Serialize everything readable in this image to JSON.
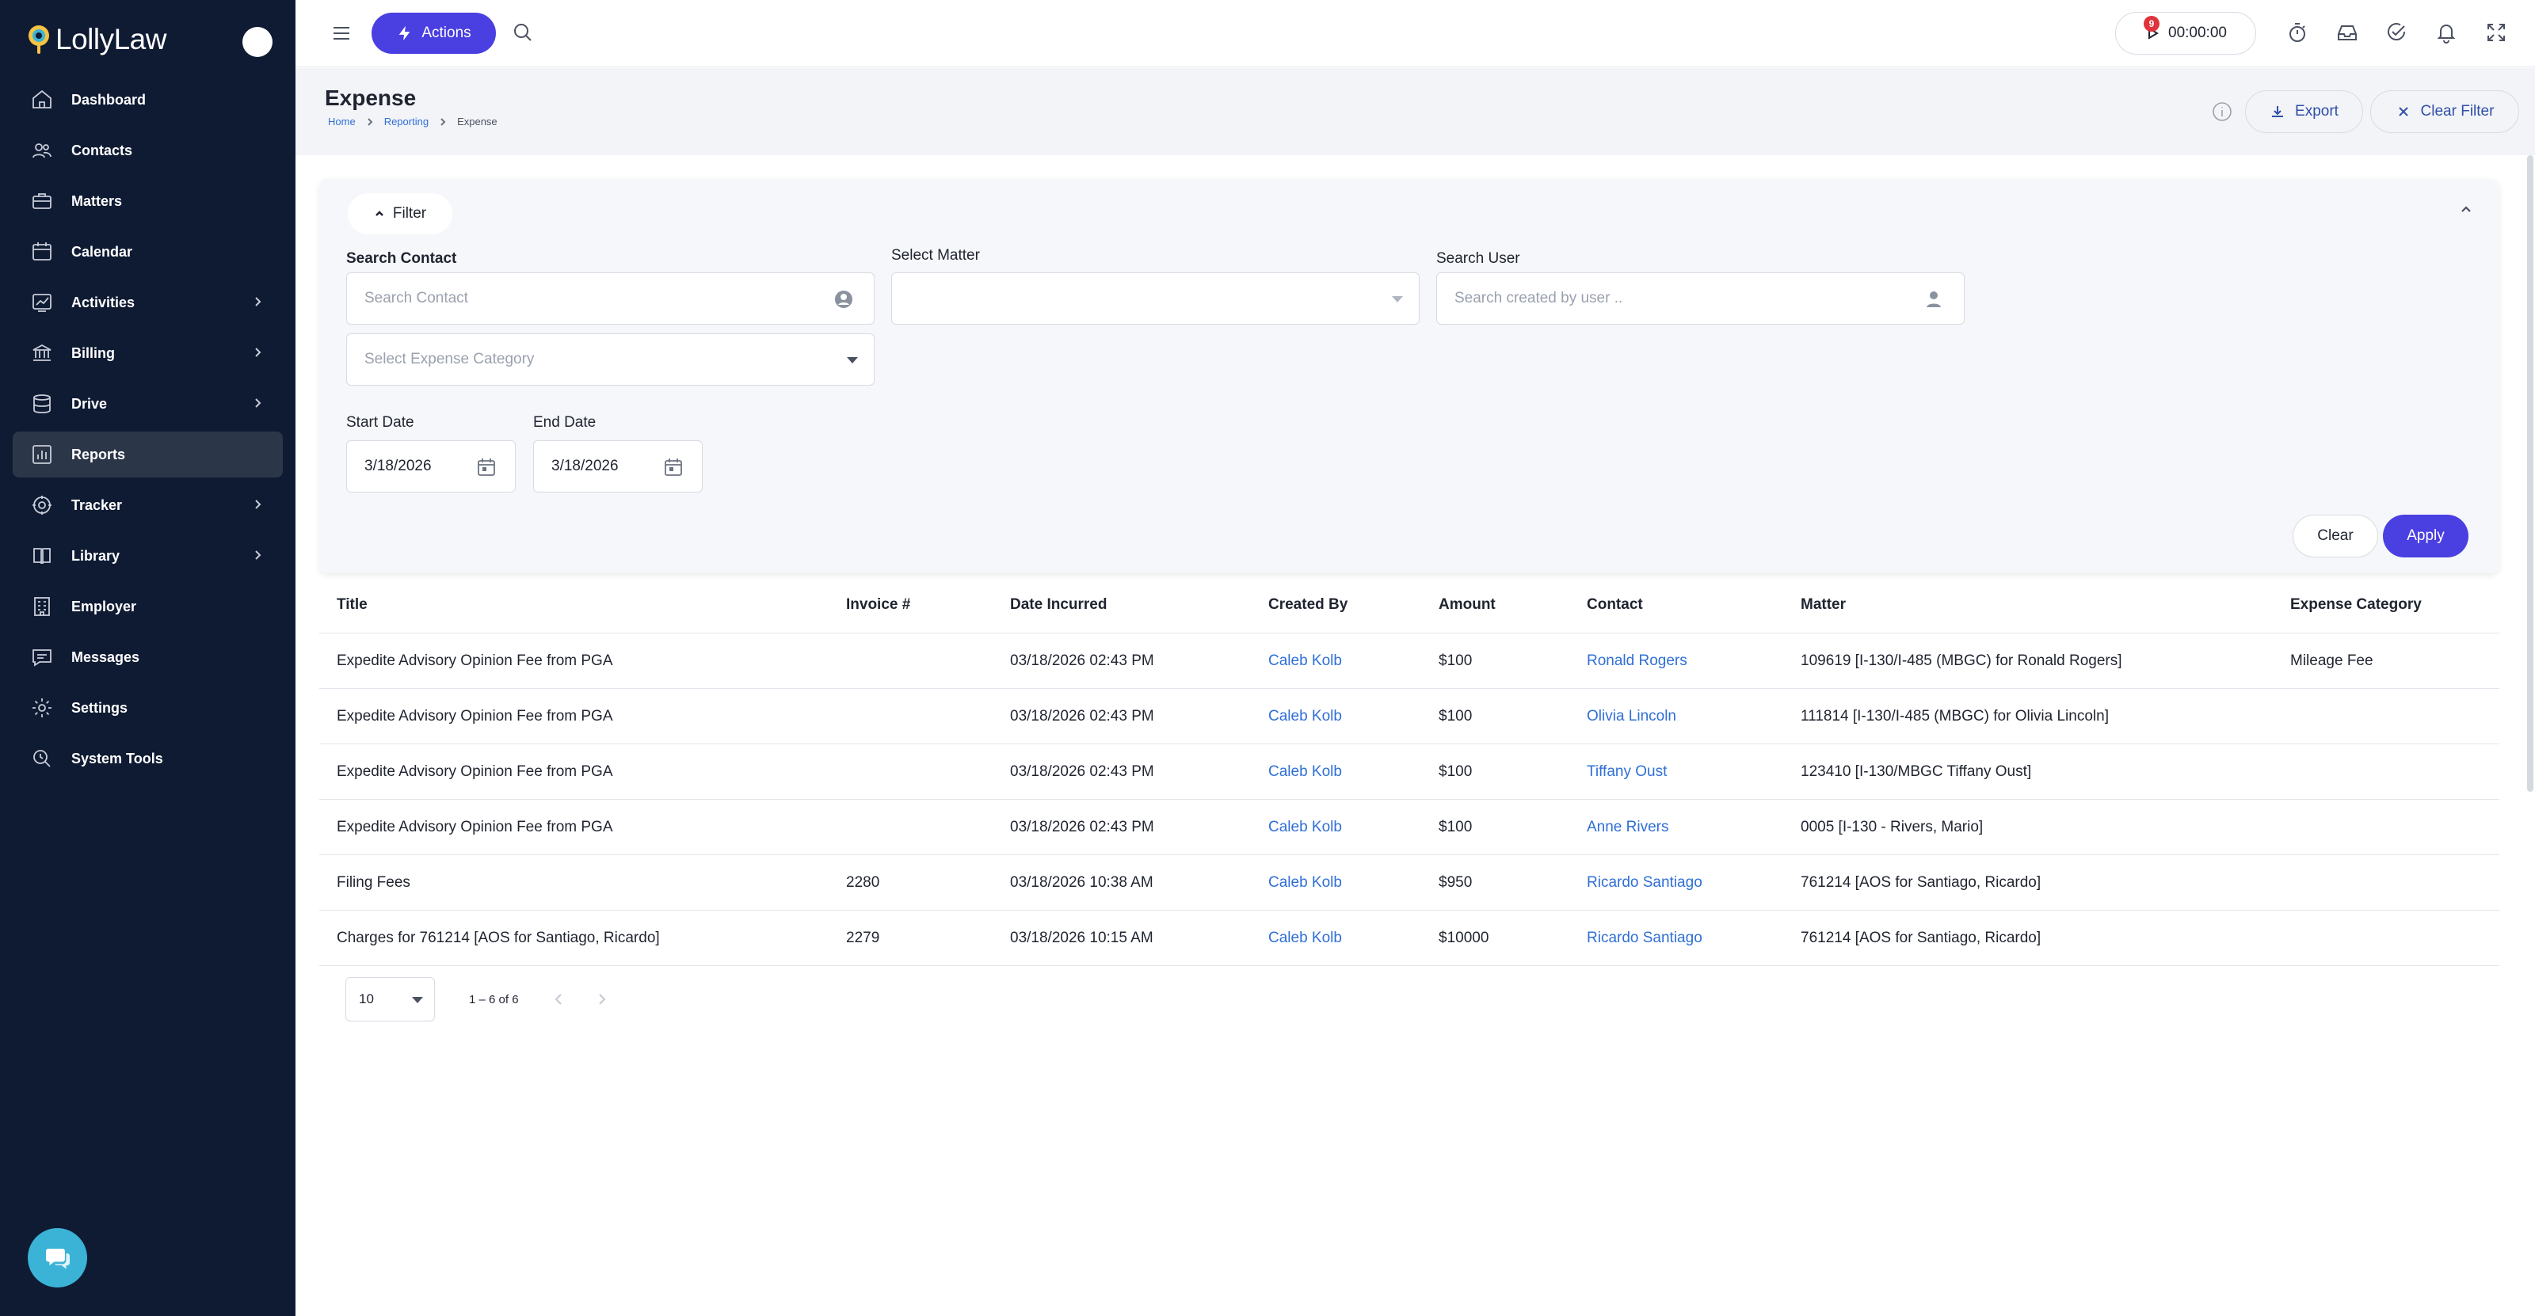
{
  "app": {
    "logo_text": "LollyLaw"
  },
  "sidebar": {
    "items": [
      {
        "label": "Dashboard",
        "icon": "home-icon",
        "chevron": false,
        "active": false
      },
      {
        "label": "Contacts",
        "icon": "contacts-icon",
        "chevron": false,
        "active": false
      },
      {
        "label": "Matters",
        "icon": "briefcase-icon",
        "chevron": false,
        "active": false
      },
      {
        "label": "Calendar",
        "icon": "calendar-icon",
        "chevron": false,
        "active": false
      },
      {
        "label": "Activities",
        "icon": "activity-chart-icon",
        "chevron": true,
        "active": false
      },
      {
        "label": "Billing",
        "icon": "bank-icon",
        "chevron": true,
        "active": false
      },
      {
        "label": "Drive",
        "icon": "database-icon",
        "chevron": true,
        "active": false
      },
      {
        "label": "Reports",
        "icon": "report-chart-icon",
        "chevron": false,
        "active": true
      },
      {
        "label": "Tracker",
        "icon": "target-icon",
        "chevron": true,
        "active": false
      },
      {
        "label": "Library",
        "icon": "book-icon",
        "chevron": true,
        "active": false
      },
      {
        "label": "Employer",
        "icon": "building-icon",
        "chevron": false,
        "active": false
      },
      {
        "label": "Messages",
        "icon": "message-icon",
        "chevron": false,
        "active": false
      },
      {
        "label": "Settings",
        "icon": "gear-icon",
        "chevron": false,
        "active": false
      },
      {
        "label": "System Tools",
        "icon": "tools-icon",
        "chevron": false,
        "active": false
      }
    ]
  },
  "topbar": {
    "actions_label": "Actions",
    "timer": "00:00:00",
    "notification_count": "9"
  },
  "header": {
    "title": "Expense",
    "breadcrumb": [
      "Home",
      "Reporting",
      "Expense"
    ],
    "export_label": "Export",
    "clear_filter_label": "Clear Filter"
  },
  "filter": {
    "toggle_label": "Filter",
    "search_contact_label": "Search Contact",
    "search_contact_placeholder": "Search Contact",
    "select_matter_label": "Select Matter",
    "search_user_label": "Search User",
    "search_user_placeholder": "Search created by user ..",
    "expense_category_placeholder": "Select Expense Category",
    "start_date_label": "Start Date",
    "start_date_value": "3/18/2026",
    "end_date_label": "End Date",
    "end_date_value": "3/18/2026",
    "clear_label": "Clear",
    "apply_label": "Apply"
  },
  "table": {
    "columns": [
      "Title",
      "Invoice #",
      "Date Incurred",
      "Created By",
      "Amount",
      "Contact",
      "Matter",
      "Expense Category"
    ],
    "rows": [
      {
        "title": "Expedite Advisory Opinion Fee from PGA",
        "invoice": "",
        "date": "03/18/2026 02:43 PM",
        "created_by": "Caleb Kolb",
        "amount": "$100",
        "contact": "Ronald Rogers",
        "matter": "109619 [I-130/I-485 (MBGC) for Ronald Rogers]",
        "category": "Mileage Fee"
      },
      {
        "title": "Expedite Advisory Opinion Fee from PGA",
        "invoice": "",
        "date": "03/18/2026 02:43 PM",
        "created_by": "Caleb Kolb",
        "amount": "$100",
        "contact": "Olivia Lincoln",
        "matter": "111814 [I-130/I-485 (MBGC) for Olivia Lincoln]",
        "category": ""
      },
      {
        "title": "Expedite Advisory Opinion Fee from PGA",
        "invoice": "",
        "date": "03/18/2026 02:43 PM",
        "created_by": "Caleb Kolb",
        "amount": "$100",
        "contact": "Tiffany Oust",
        "matter": "123410 [I-130/MBGC Tiffany Oust]",
        "category": ""
      },
      {
        "title": "Expedite Advisory Opinion Fee from PGA",
        "invoice": "",
        "date": "03/18/2026 02:43 PM",
        "created_by": "Caleb Kolb",
        "amount": "$100",
        "contact": "Anne Rivers",
        "matter": "0005 [I-130 - Rivers, Mario]",
        "category": ""
      },
      {
        "title": "Filing Fees",
        "invoice": "2280",
        "date": "03/18/2026 10:38 AM",
        "created_by": "Caleb Kolb",
        "amount": "$950",
        "contact": "Ricardo Santiago",
        "matter": "761214 [AOS for Santiago, Ricardo]",
        "category": ""
      },
      {
        "title": "Charges for 761214 [AOS for Santiago, Ricardo]",
        "invoice": "2279",
        "date": "03/18/2026 10:15 AM",
        "created_by": "Caleb Kolb",
        "amount": "$10000",
        "contact": "Ricardo Santiago",
        "matter": "761214 [AOS for Santiago, Ricardo]",
        "category": ""
      }
    ]
  },
  "pagination": {
    "page_size": "10",
    "range": "1 – 6 of 6"
  },
  "colors": {
    "sidebar_bg": "#0f1b33",
    "accent": "#4a3fe0",
    "link": "#2f6fd6",
    "chat_fab": "#3bb3d6",
    "badge": "#e0333b"
  }
}
